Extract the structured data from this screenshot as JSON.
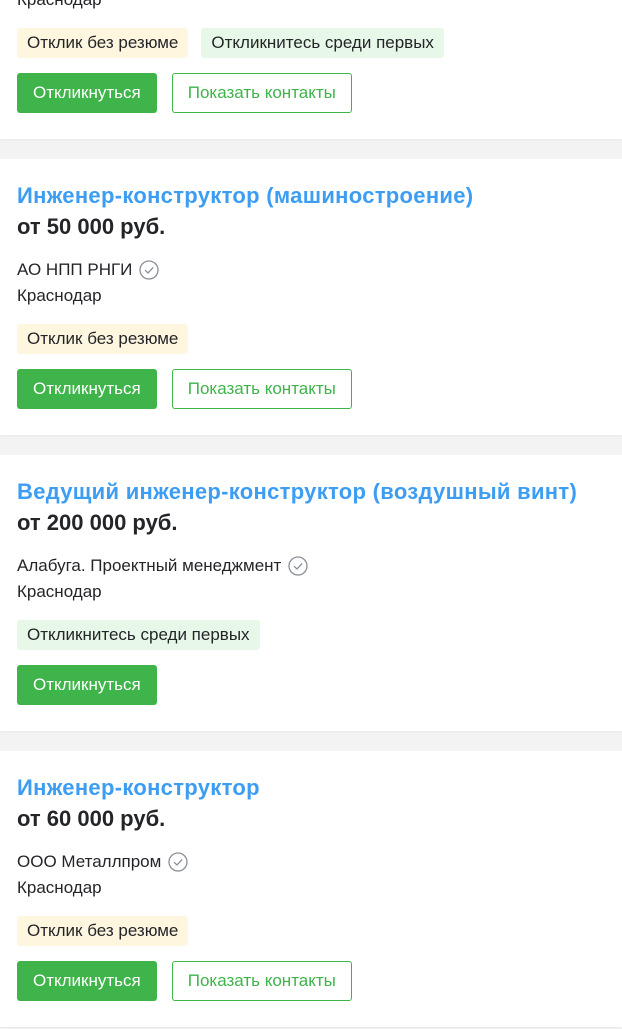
{
  "vacancies": [
    {
      "title": "",
      "salary": "",
      "company": "",
      "city": "Краснодар",
      "badges": [
        "Отклик без резюме",
        "Откликнитесь среди первых"
      ],
      "respond_label": "Откликнуться",
      "contacts_label": "Показать контакты"
    },
    {
      "title": "Инженер-конструктор (машиностроение)",
      "salary": "от 50 000 руб.",
      "company": "АО НПП РНГИ",
      "company_icon": "verified-check-icon",
      "city": "Краснодар",
      "badges": [
        "Отклик без резюме"
      ],
      "respond_label": "Откликнуться",
      "contacts_label": "Показать контакты"
    },
    {
      "title": "Ведущий инженер-конструктор (воздушный винт)",
      "salary": "от 200 000 руб.",
      "company": "Алабуга. Проектный менеджмент",
      "company_icon": "verified-check-icon",
      "city": "Краснодар",
      "badges": [
        "Откликнитесь среди первых"
      ],
      "respond_label": "Откликнуться"
    },
    {
      "title": "Инженер-конструктор",
      "salary": "от 60 000 руб.",
      "company": "ООО Металлпром",
      "company_icon": "verified-check-icon",
      "city": "Краснодар",
      "badges": [
        "Отклик без резюме"
      ],
      "respond_label": "Откликнуться",
      "contacts_label": "Показать контакты"
    }
  ],
  "colors": {
    "title_link": "#3c9df2",
    "primary_button": "#3eb44a",
    "badge_no_resume": "#fff6e0",
    "badge_first": "#e8f8e8",
    "page_background": "#f3f3f3"
  }
}
